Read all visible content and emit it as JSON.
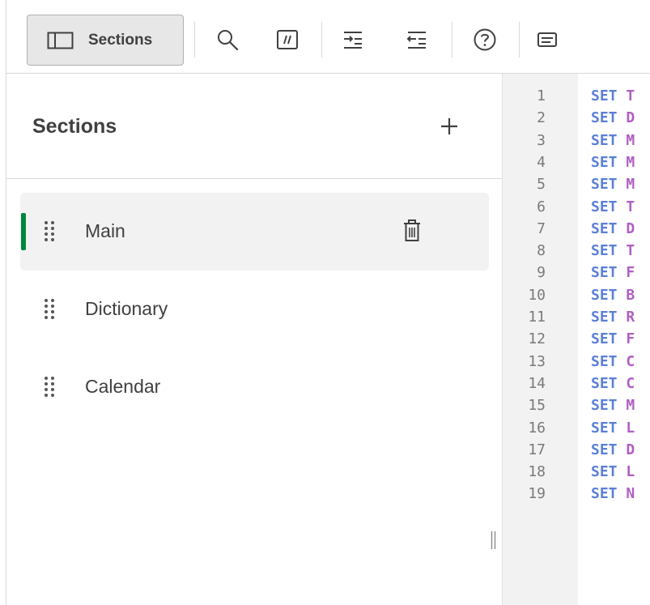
{
  "toolbar": {
    "sections_label": "Sections",
    "icons": [
      "search-icon",
      "comment-icon",
      "indent-icon",
      "outdent-icon",
      "help-icon",
      "keyboard-shortcuts-icon"
    ]
  },
  "panel": {
    "title": "Sections",
    "add_icon": "plus-icon",
    "items": [
      {
        "label": "Main",
        "active": true
      },
      {
        "label": "Dictionary",
        "active": false
      },
      {
        "label": "Calendar",
        "active": false
      }
    ]
  },
  "editor": {
    "lines": [
      {
        "no": "1",
        "kw": "SET",
        "rest": "T"
      },
      {
        "no": "2",
        "kw": "SET",
        "rest": "D"
      },
      {
        "no": "3",
        "kw": "SET",
        "rest": "M"
      },
      {
        "no": "4",
        "kw": "SET",
        "rest": "M"
      },
      {
        "no": "5",
        "kw": "SET",
        "rest": "M"
      },
      {
        "no": "6",
        "kw": "SET",
        "rest": "T"
      },
      {
        "no": "7",
        "kw": "SET",
        "rest": "D"
      },
      {
        "no": "8",
        "kw": "SET",
        "rest": "T"
      },
      {
        "no": "9",
        "kw": "SET",
        "rest": "F"
      },
      {
        "no": "10",
        "kw": "SET",
        "rest": "B"
      },
      {
        "no": "11",
        "kw": "SET",
        "rest": "R"
      },
      {
        "no": "12",
        "kw": "SET",
        "rest": "F"
      },
      {
        "no": "13",
        "kw": "SET",
        "rest": "C"
      },
      {
        "no": "14",
        "kw": "SET",
        "rest": "C"
      },
      {
        "no": "15",
        "kw": "SET",
        "rest": "M"
      },
      {
        "no": "16",
        "kw": "SET",
        "rest": "L"
      },
      {
        "no": "17",
        "kw": "SET",
        "rest": "D"
      },
      {
        "no": "18",
        "kw": "SET",
        "rest": "L"
      },
      {
        "no": "19",
        "kw": "SET",
        "rest": "N"
      }
    ]
  },
  "colors": {
    "accent_active": "#00873d",
    "keyword": "#5a7fd6",
    "identifier": "#b15ec4"
  }
}
